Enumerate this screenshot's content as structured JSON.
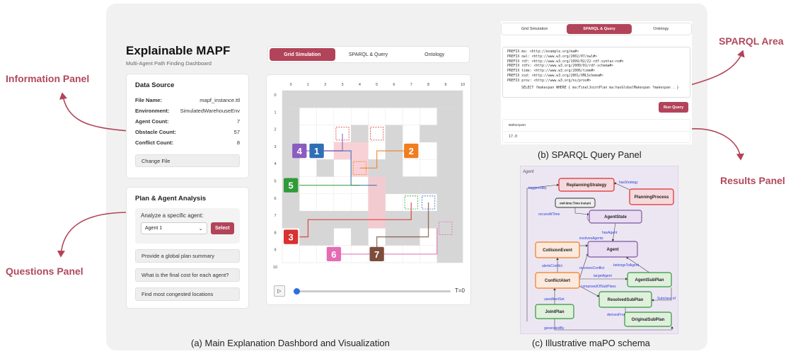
{
  "labels": {
    "information_panel": "Information Panel",
    "questions_panel": "Questions Panel",
    "sparql_area": "SPARQL Area",
    "results_panel": "Results Panel"
  },
  "captions": {
    "a": "(a) Main Explanation Dashbord and Visualization",
    "b": "(b) SPARQL Query Panel",
    "c": "(c) Illustrative maPO schema"
  },
  "dashboard": {
    "title": "Explainable MAPF",
    "subtitle": "Multi-Agent Path Finding Dashboard",
    "data_source": {
      "heading": "Data Source",
      "rows": [
        {
          "key": "File Name:",
          "value": "mapf_instance.ttl"
        },
        {
          "key": "Environment:",
          "value": "SimulatedWarehouseEnv"
        },
        {
          "key": "Agent Count:",
          "value": "7"
        },
        {
          "key": "Obstacle Count:",
          "value": "57"
        },
        {
          "key": "Conflict Count:",
          "value": "8"
        }
      ],
      "change_file": "Change File"
    },
    "analysis": {
      "heading": "Plan & Agent Analysis",
      "prompt": "Analyze a specific agent:",
      "selected_agent": "Agent 1",
      "select_button": "Select",
      "questions": [
        "Provide a global plan summary",
        "What is the final cost for each agent?",
        "Find most congested locations"
      ]
    }
  },
  "main_tabs": [
    "Grid Simulation",
    "SPARQL & Query",
    "Ontology"
  ],
  "grid": {
    "col_labels": [
      "0",
      "1",
      "2",
      "3",
      "4",
      "5",
      "6",
      "7",
      "8",
      "9",
      "10"
    ],
    "row_labels": [
      "0",
      "1",
      "2",
      "3",
      "4",
      "5",
      "6",
      "7",
      "8",
      "9",
      "10"
    ],
    "agents": [
      {
        "id": "1",
        "color": "#2f6fb5",
        "col": 1.5,
        "row": 3
      },
      {
        "id": "2",
        "color": "#f07d1f",
        "col": 7,
        "row": 3
      },
      {
        "id": "3",
        "color": "#d93030",
        "col": 0,
        "row": 8
      },
      {
        "id": "4",
        "color": "#8a5cbf",
        "col": 0.5,
        "row": 3
      },
      {
        "id": "5",
        "color": "#2f9a37",
        "col": 0,
        "row": 5
      },
      {
        "id": "6",
        "color": "#e46cb4",
        "col": 2.5,
        "row": 9
      },
      {
        "id": "7",
        "color": "#7d4d3c",
        "col": 5,
        "row": 9
      }
    ],
    "time_label": "T=0"
  },
  "sparql": {
    "tabs": [
      "Grid Simulation",
      "SPARQL & Query",
      "Ontology"
    ],
    "prefixes": [
      "PREFIX ma: <http://example.org/ma#>",
      "PREFIX owl: <http://www.w3.org/2002/07/owl#>",
      "PREFIX rdf: <http://www.w3.org/1999/02/22-rdf-syntax-ns#>",
      "PREFIX rdfs: <http://www.w3.org/2000/01/rdf-schema#>",
      "PREFIX time: <http://www.w3.org/2006/time#>",
      "PREFIX xsd: <http://www.w3.org/2001/XMLSchema#>",
      "PREFIX prov: <http://www.w3.org/ns/prov#>"
    ],
    "query": "SELECT ?makespan WHERE { ma:FinalJointPlan ma:hasGlobalMakespan ?makespan . }",
    "run_button": "Run Query",
    "result_header": "makespan",
    "result_value": "17.0"
  },
  "schema": {
    "title": "Agent",
    "nodes": {
      "replanning": "ReplanningStrategy",
      "planning": "PlanningProcess",
      "owltime": "owl-time:Time Instant",
      "agentstate": "AgentState",
      "collision": "CollisionEvent",
      "agent": "Agent",
      "conflict": "ConflictAlert",
      "agentsub": "AgentSubPlan",
      "resolved": "ResolvedSubPlan",
      "joint": "JointPlan",
      "original": "OriginalSubPlan"
    },
    "edges": {
      "hasStrategy": "hasStrategy",
      "triggeredBy": "triggeredBy",
      "occursAtTime": "occursAtTime",
      "hasAgent": "hasAgent",
      "involvesAgents": "involvesAgents",
      "alertsConflict": "alertsConflict",
      "receivesConflict": "receivesConflict",
      "targetAgent": "targetAgent",
      "belongsToAgent": "belongsToAgent",
      "composedOfSubPlans": "composedOfSubPlans",
      "usedAlertSet": "usedAlertSet",
      "derivesFrom": "derivesFrom",
      "subclassOf": "Subclass of",
      "generatedBy": "generatedBy"
    }
  }
}
